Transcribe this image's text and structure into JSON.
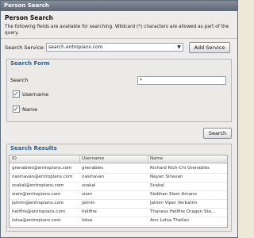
{
  "window": {
    "title": "Person Search"
  },
  "heading": "Person Search",
  "description": "The following fields are available for searching. Wildcard (*) characters are allowed as part of the query.",
  "service": {
    "label": "Search Service:",
    "value": "search.entropians.com",
    "add_label": "Add Service"
  },
  "search_form": {
    "title": "Search Form",
    "search_label": "Search",
    "search_value": "*",
    "checkboxes": [
      {
        "label": "Username",
        "checked": true
      },
      {
        "label": "Name",
        "checked": true
      }
    ]
  },
  "search_button_label": "Search",
  "results": {
    "title": "Search Results",
    "columns": [
      "ID",
      "Username",
      "Name"
    ],
    "rows": [
      [
        "grenables@entropians.com",
        "grenables",
        "Richard Rich-Chi Grenables"
      ],
      [
        "nasinavan@entropians.com",
        "nasinavan",
        "Nayan Sinavan"
      ],
      [
        "scakal@entropians.com",
        "scakal",
        "Scakal"
      ],
      [
        "siam@entropians.com",
        "siam",
        "Siobhan Siam Amano"
      ],
      [
        "jalmin@entropians.com",
        "jalmin",
        "Jalmin Viper Verbatim"
      ],
      [
        "hellfire@entropians.com",
        "hellfire",
        "Thaness Hellfire Dragon Sta..."
      ],
      [
        "lotsa@entropians.com",
        "lotsa",
        "Ann Lotsa Thellan"
      ]
    ]
  }
}
